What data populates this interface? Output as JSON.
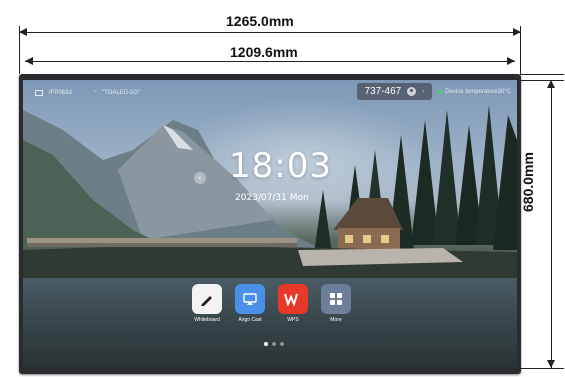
{
  "dimensions": {
    "overall_width": "1265.0mm",
    "screen_width": "1209.6mm",
    "height": "680.0mm"
  },
  "status_bar": {
    "device_id": "IFP063d",
    "wifi_name": "\"TOALED-5G\"",
    "cast_code": "737-467",
    "device_temp": "Device temperature30°C"
  },
  "clock": {
    "time": "18:03",
    "date": "2023/07/31 Mon"
  },
  "dock": {
    "apps": [
      {
        "label": "Whiteboard",
        "icon": "pen-icon",
        "color": "#f3f3f3"
      },
      {
        "label": "Airgo Cast",
        "icon": "cast-icon",
        "color": "#4a90e8"
      },
      {
        "label": "WPS",
        "icon": "wps-icon",
        "color": "#e8382a"
      },
      {
        "label": "More",
        "icon": "grid-icon",
        "color": "#6d7f9a"
      }
    ],
    "page_count": 3,
    "active_page": 0
  }
}
